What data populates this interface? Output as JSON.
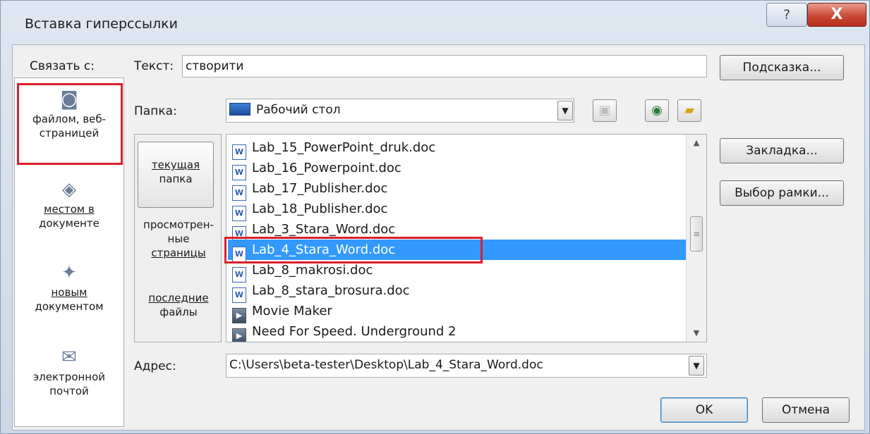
{
  "window": {
    "title": "Вставка гиперссылки",
    "help_glyph": "?",
    "close_glyph": "X"
  },
  "link_to": {
    "label": "Связать с:",
    "items": [
      {
        "label_line1": "файлом, веб-",
        "label_line2": "страницей",
        "icon": "web-page-file-icon",
        "glyph": "◙"
      },
      {
        "label_line1": "местом в",
        "label_line2": "документе",
        "icon": "document-place-icon",
        "glyph": "◈"
      },
      {
        "label_line1": "новым",
        "label_line2": "документом",
        "icon": "new-document-icon",
        "glyph": "✦"
      },
      {
        "label_line1": "электронной",
        "label_line2": "почтой",
        "icon": "email-icon",
        "glyph": "✉"
      }
    ]
  },
  "text_field": {
    "label": "Текст:",
    "value": "створити"
  },
  "buttons": {
    "tooltip": "Подсказка...",
    "bookmark": "Закладка...",
    "frame": "Выбор рамки...",
    "ok": "OK",
    "cancel": "Отмена"
  },
  "folder": {
    "label": "Папка:",
    "value": "Рабочий стол"
  },
  "nav": [
    {
      "line1": "текущая",
      "line2": "папка",
      "line3": ""
    },
    {
      "line1": "просмотрен-",
      "line2": "ные",
      "line3": "страницы"
    },
    {
      "line1": "последние",
      "line2": "файлы",
      "line3": ""
    }
  ],
  "files": [
    {
      "name": "Lab_15_PowerPoint_druk.doc",
      "type": "word",
      "selected": false
    },
    {
      "name": "Lab_16_Powerpoint.doc",
      "type": "word",
      "selected": false
    },
    {
      "name": "Lab_17_Publisher.doc",
      "type": "word",
      "selected": false
    },
    {
      "name": "Lab_18_Publisher.doc",
      "type": "word",
      "selected": false
    },
    {
      "name": "Lab_3_Stara_Word.doc",
      "type": "word",
      "selected": false
    },
    {
      "name": "Lab_4_Stara_Word.doc",
      "type": "word",
      "selected": true
    },
    {
      "name": "Lab_8_makrosi.doc",
      "type": "word",
      "selected": false
    },
    {
      "name": "Lab_8_stara_brosura.doc",
      "type": "word",
      "selected": false
    },
    {
      "name": "Movie Maker",
      "type": "shortcut",
      "selected": false
    },
    {
      "name": "Need For Speed. Underground 2",
      "type": "shortcut",
      "selected": false
    }
  ],
  "address": {
    "label": "Адрес:",
    "value": "C:\\Users\\beta-tester\\Desktop\\Lab_4_Stara_Word.doc"
  },
  "colors": {
    "selection": "#3399ff",
    "highlight_box": "#d9202b"
  }
}
